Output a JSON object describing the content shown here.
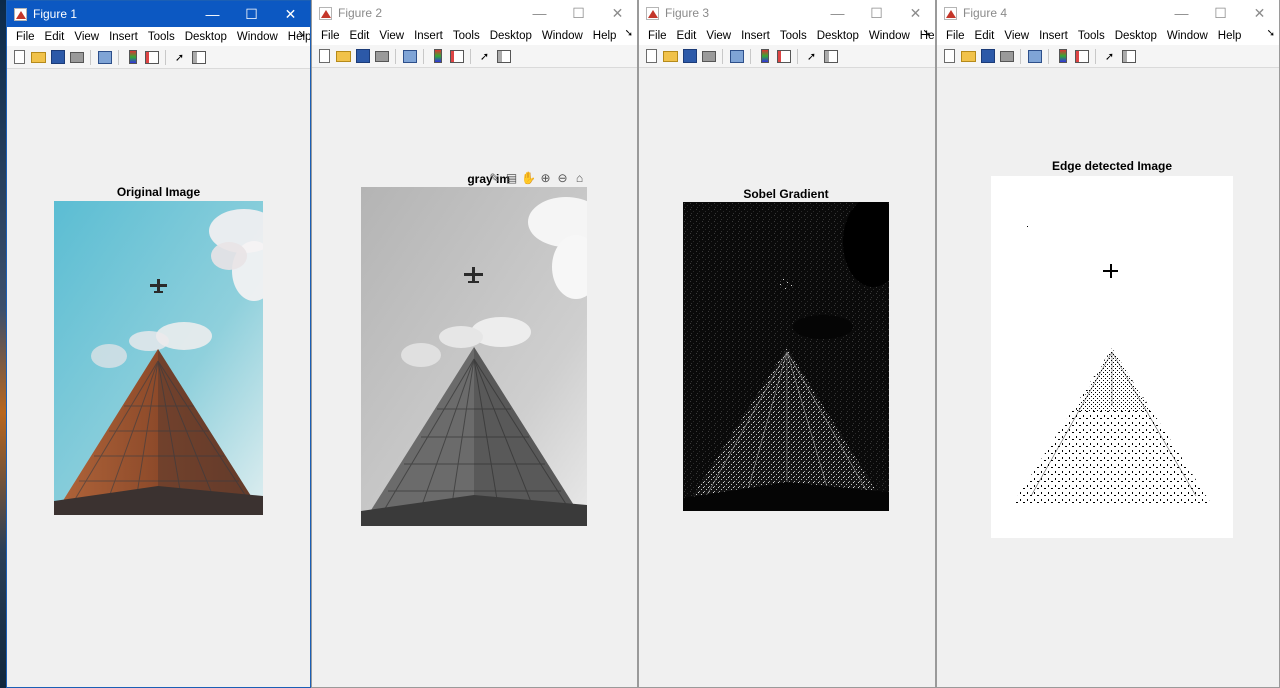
{
  "menus": [
    "File",
    "Edit",
    "View",
    "Insert",
    "Tools",
    "Desktop",
    "Window",
    "Help"
  ],
  "window_buttons": {
    "minimize": "—",
    "maximize": "☐",
    "close": "✕"
  },
  "menu_more": "➘",
  "figures": [
    {
      "title": "Figure 1",
      "plot_title": "Original Image",
      "state": "active"
    },
    {
      "title": "Figure 2",
      "plot_title": "gray im",
      "state": "inactive"
    },
    {
      "title": "Figure 3",
      "plot_title": "Sobel Gradient",
      "state": "inactive"
    },
    {
      "title": "Figure 4",
      "plot_title": "Edge detected Image",
      "state": "inactive"
    }
  ],
  "axes_toolbar_icons": [
    "brush-icon",
    "datatip-icon",
    "pan-icon",
    "zoom-in-icon",
    "zoom-out-icon",
    "home-icon"
  ],
  "axes_toolbar_glyphs": [
    "✎",
    "▤",
    "✋",
    "⊕",
    "⊖",
    "⌂"
  ],
  "colors": {
    "active_titlebar": "#0c58c2",
    "figure_bg": "#f0f0f0",
    "sky": "#6fc3d6",
    "building": "#a55a36"
  }
}
